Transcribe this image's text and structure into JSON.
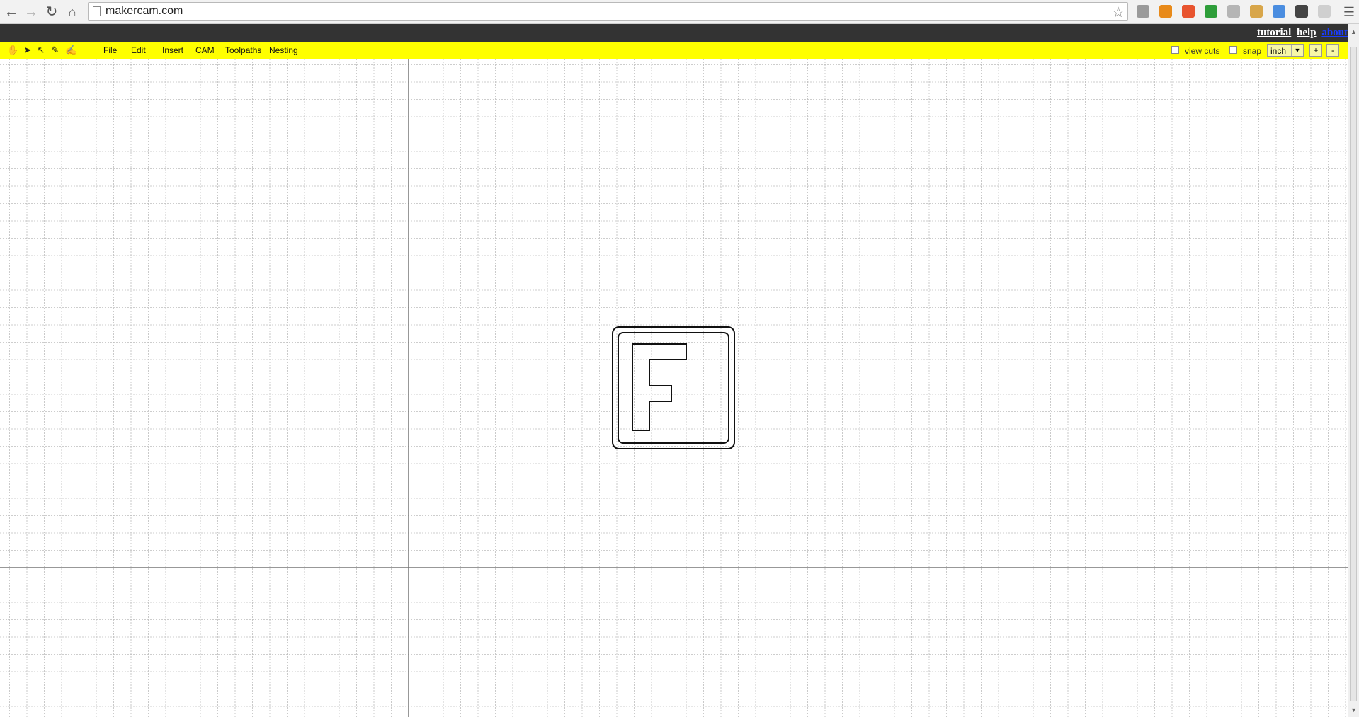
{
  "browser": {
    "url": "makercam.com",
    "nav_icons": [
      "back-arrow-icon",
      "forward-arrow-icon",
      "reload-icon",
      "home-icon"
    ],
    "bookmark_icon": "star-icon",
    "extensions": [
      {
        "name": "hourglass-extension-icon",
        "color": "#9a9a9a"
      },
      {
        "name": "chart-extension-icon",
        "color": "#e88a1a"
      },
      {
        "name": "plus-extension-icon",
        "color": "#e8542f"
      },
      {
        "name": "badge-extension-icon",
        "color": "#2e9e3a"
      },
      {
        "name": "grid-extension-icon",
        "color": "#b5b5b5"
      },
      {
        "name": "cookie-extension-icon",
        "color": "#d8a64a"
      },
      {
        "name": "pie-extension-icon",
        "color": "#4a8de0"
      },
      {
        "name": "terminal-extension-icon",
        "color": "#444444"
      },
      {
        "name": "folder-extension-icon",
        "color": "#cfcfcf"
      }
    ],
    "menu_icon": "hamburger-menu-icon"
  },
  "topbar": {
    "links": [
      {
        "label": "tutorial",
        "color": "#ffffff"
      },
      {
        "label": "help",
        "color": "#ffffff"
      },
      {
        "label": "about",
        "color": "#1a3cff"
      }
    ]
  },
  "toolbar": {
    "tools": [
      "hand-tool-icon",
      "select-arrow-icon",
      "node-select-icon",
      "pen-tool-icon",
      "point-tool-icon"
    ],
    "menus": [
      "File",
      "Edit",
      "Insert",
      "CAM",
      "Toolpaths",
      "Nesting"
    ],
    "view_cuts_label": "view cuts",
    "snap_label": "snap",
    "unit_value": "inch",
    "zoom_in_label": "+",
    "zoom_out_label": "-"
  },
  "colors": {
    "toolbar": "#ffff00",
    "topbar": "#333333",
    "grid": "#bdbdbd",
    "axis": "#777777",
    "shape_stroke": "#111111"
  }
}
